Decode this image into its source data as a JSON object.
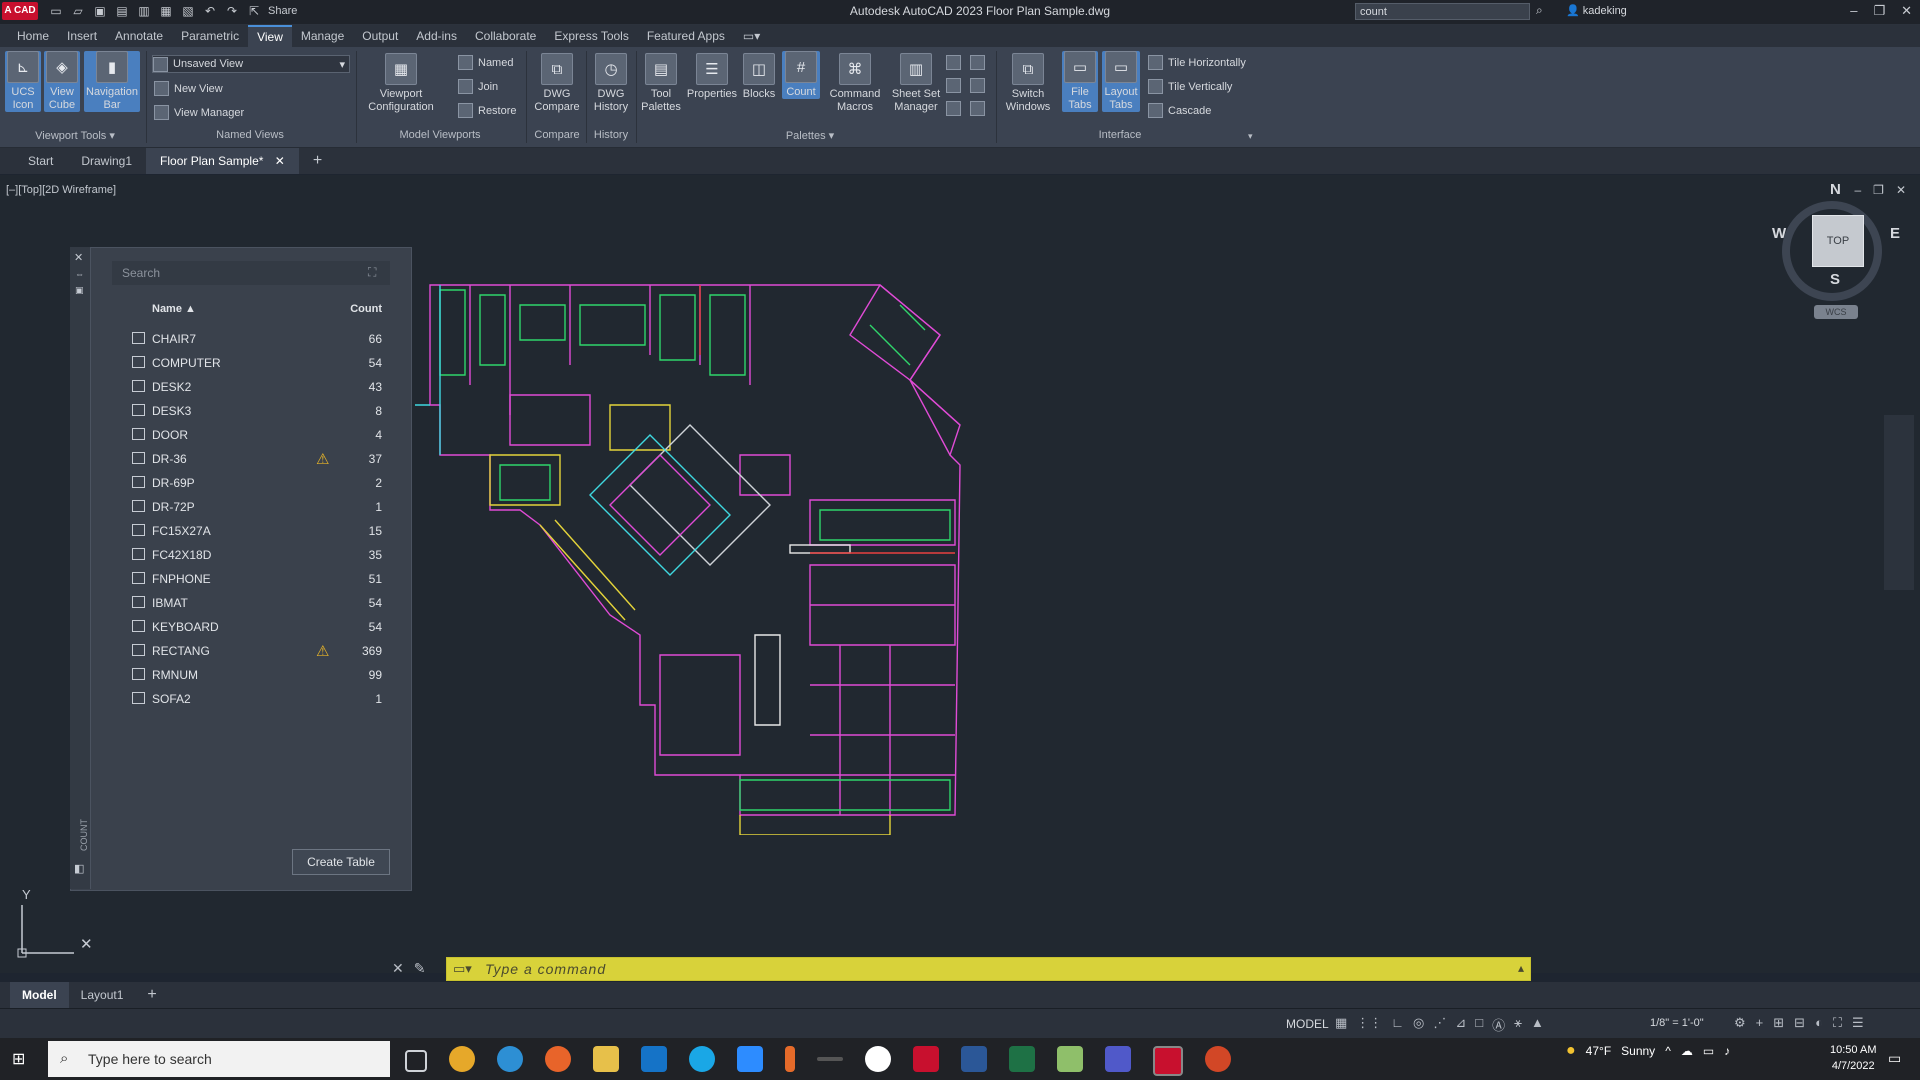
{
  "app": {
    "logo": "A CAD",
    "title": "Autodesk AutoCAD 2023   Floor Plan Sample.dwg",
    "share_label": "Share",
    "search_value": "count",
    "user_name": "kadeking"
  },
  "ribbon_tabs": [
    "Home",
    "Insert",
    "Annotate",
    "Parametric",
    "View",
    "Manage",
    "Output",
    "Add-ins",
    "Collaborate",
    "Express Tools",
    "Featured Apps"
  ],
  "ribbon": {
    "ucs_icon": "UCS Icon",
    "view_cube": "View Cube",
    "nav_bar": "Navigation Bar",
    "unsaved_view": "Unsaved View",
    "new_view": "New View",
    "view_manager": "View Manager",
    "viewport_config": "Viewport Configuration",
    "named": "Named",
    "join": "Join",
    "restore": "Restore",
    "dwg_compare": "DWG Compare",
    "dwg_history": "DWG History",
    "tool_palettes": "Tool Palettes",
    "properties": "Properties",
    "blocks": "Blocks",
    "count": "Count",
    "command_macros": "Command Macros",
    "sheet_set_manager": "Sheet Set Manager",
    "switch_windows": "Switch Windows",
    "file_tabs": "File Tabs",
    "layout_tabs": "Layout Tabs",
    "tile_horizontally": "Tile Horizontally",
    "tile_vertically": "Tile Vertically",
    "cascade": "Cascade",
    "panel_viewport_tools": "Viewport Tools",
    "panel_named_views": "Named Views",
    "panel_model_viewports": "Model Viewports",
    "panel_compare": "Compare",
    "panel_history": "History",
    "panel_palettes": "Palettes",
    "panel_interface": "Interface"
  },
  "doc_tabs": [
    "Start",
    "Drawing1",
    "Floor Plan Sample*"
  ],
  "viewport": {
    "label": "[–][Top][2D Wireframe]"
  },
  "count_palette": {
    "search_placeholder": "Search",
    "col_name": "Name ▲",
    "col_count": "Count",
    "rows": [
      {
        "name": "CHAIR7",
        "count": "66",
        "warn": false
      },
      {
        "name": "COMPUTER",
        "count": "54",
        "warn": false
      },
      {
        "name": "DESK2",
        "count": "43",
        "warn": false
      },
      {
        "name": "DESK3",
        "count": "8",
        "warn": false
      },
      {
        "name": "DOOR",
        "count": "4",
        "warn": false
      },
      {
        "name": "DR-36",
        "count": "37",
        "warn": true
      },
      {
        "name": "DR-69P",
        "count": "2",
        "warn": false
      },
      {
        "name": "DR-72P",
        "count": "1",
        "warn": false
      },
      {
        "name": "FC15X27A",
        "count": "15",
        "warn": false
      },
      {
        "name": "FC42X18D",
        "count": "35",
        "warn": false
      },
      {
        "name": "FNPHONE",
        "count": "51",
        "warn": false
      },
      {
        "name": "IBMAT",
        "count": "54",
        "warn": false
      },
      {
        "name": "KEYBOARD",
        "count": "54",
        "warn": false
      },
      {
        "name": "RECTANG",
        "count": "369",
        "warn": true
      },
      {
        "name": "RMNUM",
        "count": "99",
        "warn": false
      },
      {
        "name": "SOFA2",
        "count": "1",
        "warn": false
      }
    ],
    "create_table": "Create Table",
    "side_label": "COUNT"
  },
  "viewcube": {
    "north": "N",
    "south": "S",
    "east": "E",
    "west": "W",
    "face": "TOP",
    "wcs": "WCS"
  },
  "command_line": {
    "placeholder": "Type  a  command"
  },
  "layout_tabs": [
    "Model",
    "Layout1"
  ],
  "status": {
    "model": "MODEL",
    "scale": "1/8\" = 1'-0\""
  },
  "taskbar": {
    "search_placeholder": "Type here to search",
    "weather_temp": "47°F",
    "weather_text": "Sunny",
    "time": "10:50 AM",
    "date": "4/7/2022"
  },
  "colors": {
    "accent": "#4a8fd8",
    "cmd_bar": "#d8d23a",
    "plan_magenta": "#e04bd6",
    "plan_green": "#2fd66b",
    "plan_yellow": "#e4d43a",
    "plan_cyan": "#3fd8e0"
  }
}
